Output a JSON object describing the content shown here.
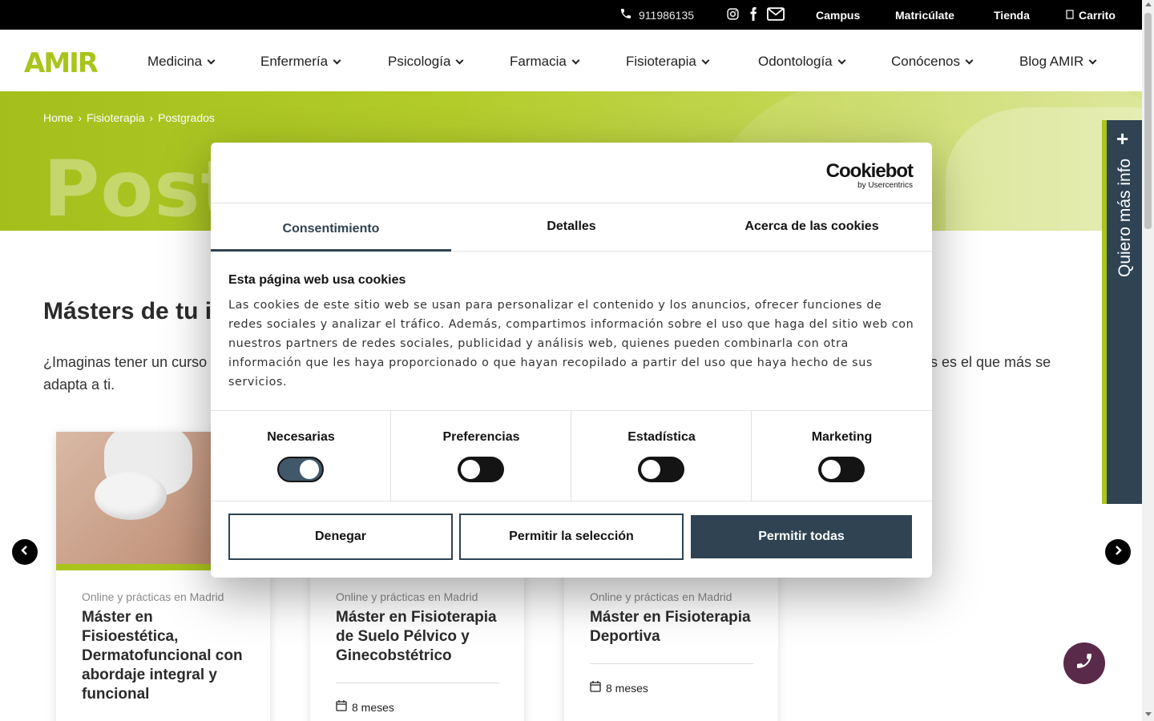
{
  "topbar": {
    "phone": "911986135",
    "links": [
      "Campus",
      "Matricúlate",
      "Tienda"
    ],
    "cart": "Carrito"
  },
  "header": {
    "logo": "AMIR",
    "nav": [
      "Medicina",
      "Enfermería",
      "Psicología",
      "Farmacia",
      "Fisioterapia",
      "Odontología",
      "Conócenos",
      "Blog AMIR"
    ]
  },
  "breadcrumb": [
    "Home",
    "Fisioterapia",
    "Postgrados"
  ],
  "hero_title": "Postgrados",
  "side_tab": "Quiero más info",
  "main": {
    "heading": "Másters de tu interés",
    "intro_left": "¿Imaginas tener un curso",
    "intro_right": "rsos es el que más se",
    "intro_line2": "adapta a ti."
  },
  "cards": [
    {
      "mode": "Online y prácticas en Madrid",
      "title": "Máster en Fisioestética, Dermatofuncional con abordaje integral y funcional",
      "duration": ""
    },
    {
      "mode": "Online y prácticas en Madrid",
      "title": "Máster en Fisioterapia de Suelo Pélvico y Ginecobstétrico",
      "duration": "8 meses"
    },
    {
      "mode": "Online y prácticas en Madrid",
      "title": "Máster en Fisioterapia Deportiva",
      "duration": "8 meses"
    }
  ],
  "cookie": {
    "brand": "Cookiebot",
    "brand_sub": "by Usercentrics",
    "tabs": [
      "Consentimiento",
      "Detalles",
      "Acerca de las cookies"
    ],
    "heading": "Esta página web usa cookies",
    "body": "Las cookies de este sitio web se usan para personalizar el contenido y los anuncios, ofrecer funciones de redes sociales y analizar el tráfico. Además, compartimos información sobre el uso que haga del sitio web con nuestros partners de redes sociales, publicidad y análisis web, quienes pueden combinarla con otra información que les haya proporcionado o que hayan recopilado a partir del uso que haya hecho de sus servicios.",
    "categories": [
      {
        "label": "Necesarias",
        "on": true
      },
      {
        "label": "Preferencias",
        "on": false
      },
      {
        "label": "Estadística",
        "on": false
      },
      {
        "label": "Marketing",
        "on": false
      }
    ],
    "buttons": {
      "deny": "Denegar",
      "allow_selection": "Permitir la selección",
      "allow_all": "Permitir todas"
    }
  },
  "colors": {
    "brand_green": "#a9c41b",
    "dark_blue": "#2f4352",
    "call_button": "#5a2a4a"
  },
  "icons": [
    "phone-icon",
    "instagram-icon",
    "facebook-icon",
    "mail-icon",
    "cart-icon",
    "chevron-down-icon",
    "plus-icon",
    "arrow-left-icon",
    "arrow-right-icon",
    "calendar-icon",
    "phone-call-icon"
  ]
}
